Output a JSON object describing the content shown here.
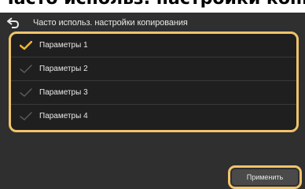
{
  "caption": {
    "text": "Часто использ. настройки копирования"
  },
  "header": {
    "back_icon": "back-arrow-icon",
    "title": "Часто использ. настройки копирования"
  },
  "list": {
    "items": [
      {
        "label": "Параметры 1",
        "checked": true
      },
      {
        "label": "Параметры 2",
        "checked": false
      },
      {
        "label": "Параметры 3",
        "checked": false
      },
      {
        "label": "Параметры 4",
        "checked": false
      }
    ]
  },
  "footer": {
    "apply_label": "Применить"
  },
  "colors": {
    "panel_background": "#2f2f2f",
    "list_background": "#1f1f1f",
    "highlight_frame": "#f0c36a",
    "check_active": "#f2b233",
    "check_inactive": "#5a5a5a",
    "text": "#e8e8e8"
  }
}
